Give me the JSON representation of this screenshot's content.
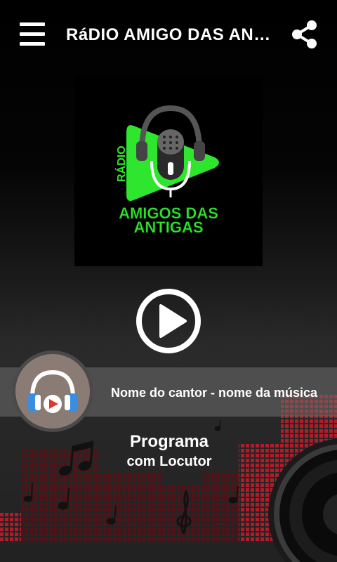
{
  "header": {
    "title": "RáDIO AMIGO DAS ANTIGAS",
    "menu_icon": "hamburger-menu-icon",
    "share_icon": "share-icon"
  },
  "logo": {
    "line1": "RÁDIO",
    "line2": "AMIGOS DAS",
    "line3": "ANTIGAS",
    "accent_color": "#2ee62e"
  },
  "player": {
    "play_icon": "play-icon",
    "now_playing": "Nome do cantor - nome da música"
  },
  "program": {
    "title": "Programa",
    "subtitle": "com Locutor"
  },
  "colors": {
    "background": "#000000",
    "now_playing_bar": "#6e6e6e",
    "album_bg": "#8a7b74",
    "equalizer": "#c41a2a"
  }
}
